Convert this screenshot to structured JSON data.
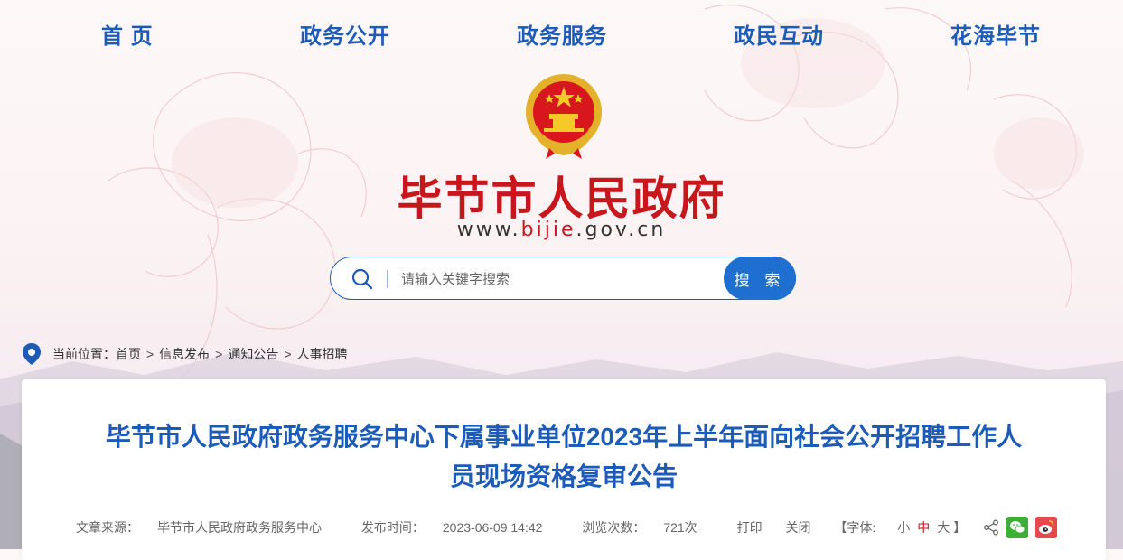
{
  "nav": {
    "items": [
      "首 页",
      "政务公开",
      "政务服务",
      "政民互动",
      "花海毕节"
    ]
  },
  "header": {
    "site_title": "毕节市人民政府",
    "url_prefix": "www.",
    "url_highlight": "bijie",
    "url_suffix": ".gov.cn"
  },
  "search": {
    "placeholder": "请输入关键字搜索",
    "button_label": "搜 索"
  },
  "breadcrumb": {
    "label": "当前位置：",
    "items": [
      "首页",
      "信息发布",
      "通知公告",
      "人事招聘"
    ],
    "separator": ">"
  },
  "article": {
    "title_line1": "毕节市人民政府政务服务中心下属事业单位2023年上半年面向社会公开招聘工作人",
    "title_line2": "员现场资格复审公告",
    "source_label": "文章来源：",
    "source": "毕节市人民政府政务服务中心",
    "time_label": "发布时间：",
    "time": "2023-06-09 14:42",
    "views_label": "浏览次数：",
    "views": "721次",
    "print": "打印",
    "close": "关闭",
    "font_label": "【字体:",
    "font_small": "小",
    "font_medium": "中",
    "font_large": "大",
    "font_end": "】"
  },
  "colors": {
    "nav_blue": "#1c5bb8",
    "title_red": "#c8161d",
    "button_blue": "#1f6fd0"
  }
}
